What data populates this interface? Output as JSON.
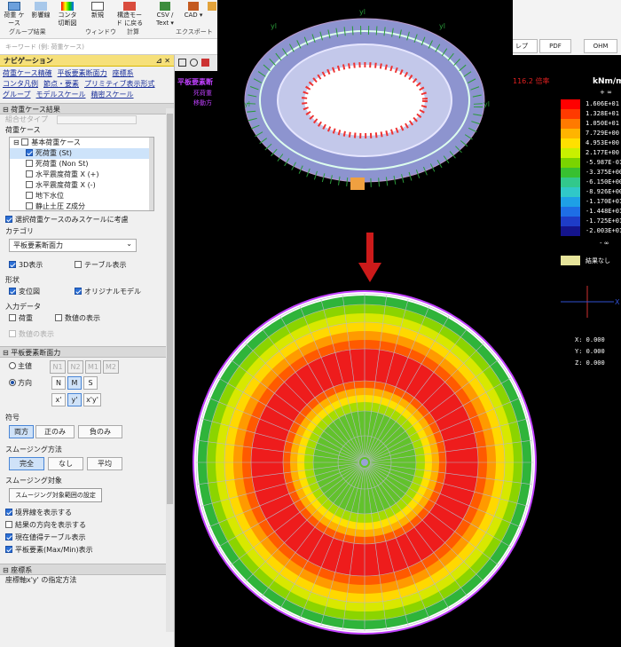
{
  "ribbon": {
    "buttons": [
      "荷重\nケース",
      "影響線",
      "コンタ\n切断図",
      "新規",
      "",
      "構造モード\nに戻る",
      "CSV /\nText ▾",
      "CAD\n▾",
      ""
    ],
    "groups": [
      "グループ結果",
      "ウィンドウ",
      "計算",
      "エクスポート"
    ],
    "right_buttons": [
      "レプ",
      "PDF",
      "OHM"
    ],
    "keyword_placeholder": "キーワード (例: 荷重ケース)"
  },
  "nav": {
    "title": "ナビゲーション",
    "pin": "⊿ ✕",
    "links": [
      "荷重ケース精確",
      "平板要素断面力",
      "座標系",
      "コンタ凡例",
      "節点・要素",
      "プリミティブ表示形式",
      "グループ",
      "モデルスケール",
      "精密スケール"
    ],
    "section_loadcase": "荷重ケース結果",
    "combo_type_label": "組合せタイプ",
    "loadcase_label": "荷重ケース",
    "tree": [
      "基本荷重ケース",
      "死荷重 (St)",
      "死荷重 (Non St)",
      "水平震度荷重 X (+)",
      "水平震度荷重 X (-)",
      "地下水位",
      "静止土圧 Z成分"
    ],
    "scale_check": "選択荷重ケースのみスケールに考慮",
    "category_label": "カテゴリ",
    "category_value": "平板要素断面力",
    "show_3d": "3D表示",
    "show_table": "テーブル表示",
    "shape_label": "形状",
    "deformed": "変位図",
    "original_model": "オリジナルモデル",
    "input_data_label": "入力データ",
    "load": "荷重",
    "numeric": "数値の表示",
    "fill_disp": "数値の表示",
    "section_plate": "平板要素断面力",
    "principal": "主値",
    "direction": "方向",
    "p_buttons": [
      "N1",
      "N2",
      "M1",
      "M2"
    ],
    "dir_buttons_1": [
      "N",
      "M",
      "S"
    ],
    "dir_buttons_2": [
      "x'",
      "y'",
      "x'y'"
    ],
    "sign_label": "符号",
    "sign_buttons": [
      "両方",
      "正のみ",
      "負のみ"
    ],
    "smoothing_label": "スムージング方法",
    "smoothing_buttons": [
      "完全",
      "なし",
      "平均"
    ],
    "smoothing_target_label": "スムージング対象",
    "smoothing_target_btn": "スムージング対象範囲の設定",
    "chk_boundary": "境界線を表示する",
    "chk_result_dir": "結果の方向を表示する",
    "chk_current_table": "現在値得テーブル表示",
    "chk_maxmin": "平板要素(Max/Min)表示",
    "section_coord": "座標系",
    "coord_method": "座標軸x'y' の指定方法"
  },
  "viewport": {
    "title_red": "平板要素断",
    "sub1": "死荷重",
    "sub2": "移動方",
    "scale_text": "116.2 倍率",
    "legend_unit": "kNm/m",
    "legend_top": "+ ∞",
    "legend_bottom": "- ∞",
    "legend": [
      {
        "c": "#ff0000",
        "t": "1.606E+01"
      },
      {
        "c": "#ff3a00",
        "t": "1.328E+01"
      },
      {
        "c": "#ff7a00",
        "t": "1.050E+01"
      },
      {
        "c": "#ffb400",
        "t": "7.729E+00"
      },
      {
        "c": "#ffe000",
        "t": "4.953E+00"
      },
      {
        "c": "#c8f000",
        "t": "2.177E+00"
      },
      {
        "c": "#7ad400",
        "t": "-5.987E-01"
      },
      {
        "c": "#38c030",
        "t": "-3.375E+00"
      },
      {
        "c": "#32c88c",
        "t": "-6.150E+00"
      },
      {
        "c": "#30c8c8",
        "t": "-8.926E+00"
      },
      {
        "c": "#1ea0e6",
        "t": "-1.170E+01"
      },
      {
        "c": "#1e6ee6",
        "t": "-1.448E+01"
      },
      {
        "c": "#1e3cc8",
        "t": "-1.725E+01"
      },
      {
        "c": "#14148c",
        "t": "-2.003E+01"
      }
    ],
    "no_result": "結果なし",
    "coords": [
      "X: 0.000",
      "Y: 0.000",
      "Z: 0.000"
    ],
    "axis_x": "X",
    "axis_label": "yl"
  }
}
